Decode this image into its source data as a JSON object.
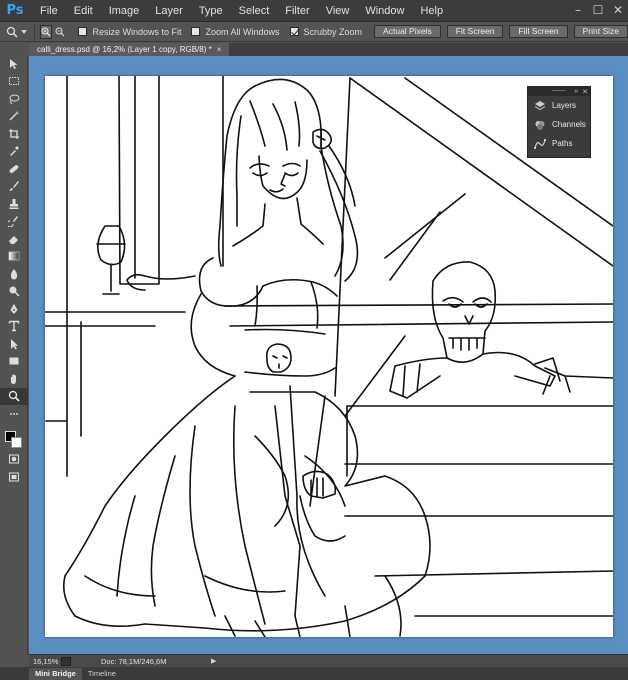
{
  "app": {
    "logo": "Ps",
    "menu": [
      "File",
      "Edit",
      "Image",
      "Layer",
      "Type",
      "Select",
      "Filter",
      "View",
      "Window",
      "Help"
    ],
    "window_controls": [
      "–",
      "☐",
      "✕"
    ]
  },
  "options_bar": {
    "resize_windows": "Resize Windows to Fit",
    "resize_checked": false,
    "zoom_all": "Zoom All Windows",
    "zoom_all_checked": false,
    "scrubby_zoom": "Scrubby Zoom",
    "scrubby_checked": true,
    "buttons": [
      "Actual Pixels",
      "Fit Screen",
      "Fill Screen",
      "Print Size"
    ]
  },
  "document": {
    "tab_title": "calli_dress.psd @ 16,2% (Layer 1 copy, RGB/8) *",
    "close_glyph": "×",
    "canvas_bg_color": "#5b8ec2"
  },
  "panel": {
    "header_glyphs": [
      "»",
      "✕"
    ],
    "items": [
      {
        "label": "Layers",
        "icon": "layers-icon"
      },
      {
        "label": "Channels",
        "icon": "channels-icon"
      },
      {
        "label": "Paths",
        "icon": "paths-icon"
      }
    ]
  },
  "status": {
    "zoom": "16,15%",
    "doc_info": "Doc: 78,1M/246,6M",
    "arrow": "▶"
  },
  "bottom_tabs": [
    "Mini Bridge",
    "Timeline"
  ],
  "tools": [
    "move-tool",
    "marquee-tool",
    "lasso-tool",
    "quick-select-tool",
    "crop-tool",
    "eyedropper-tool",
    "healing-brush-tool",
    "brush-tool",
    "clone-stamp-tool",
    "history-brush-tool",
    "eraser-tool",
    "gradient-tool",
    "blur-tool",
    "dodge-tool",
    "pen-tool",
    "type-tool",
    "path-select-tool",
    "shape-tool",
    "hand-tool",
    "zoom-tool"
  ]
}
